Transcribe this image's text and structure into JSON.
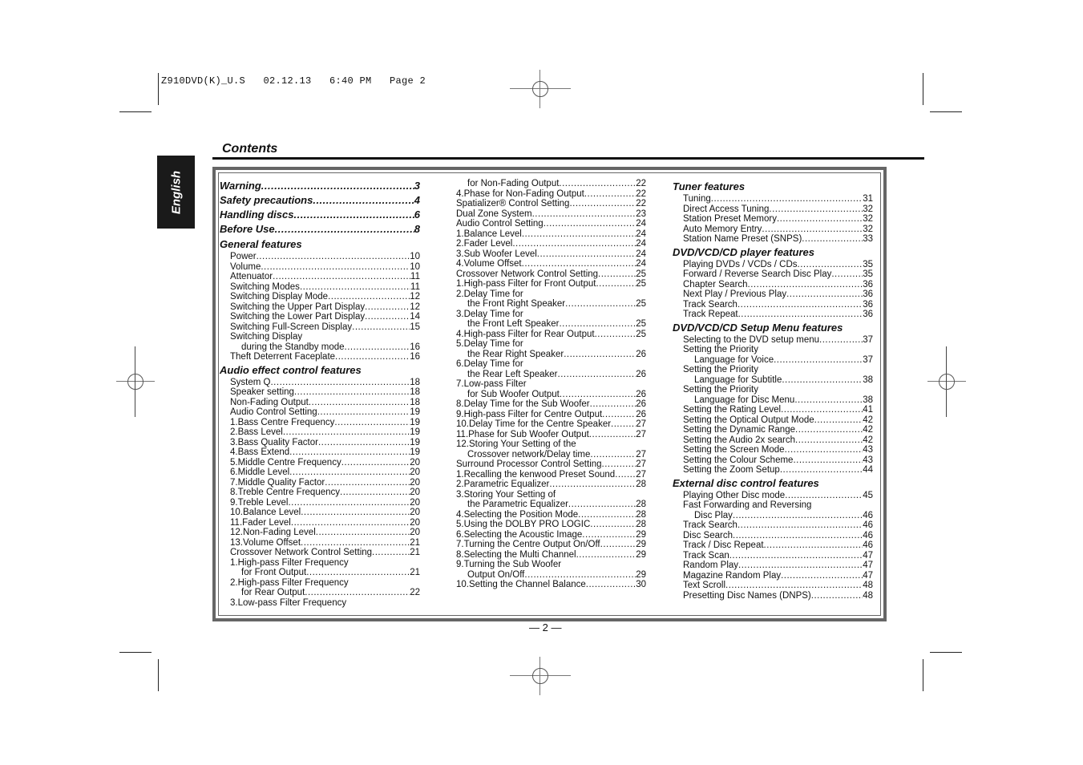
{
  "print_slug": "Z910DVD(K)_U.S   02.12.13   6:40 PM   Page 2",
  "language_tab": "English",
  "title": "Contents",
  "page_number": "— 2 —",
  "columns": [
    [
      {
        "type": "major",
        "text": "Warning",
        "page": "3"
      },
      {
        "type": "major",
        "text": "Safety precautions",
        "page": "4"
      },
      {
        "type": "major",
        "text": "Handling discs",
        "page": "6"
      },
      {
        "type": "major",
        "text": "Before Use",
        "page": "8"
      },
      {
        "type": "section",
        "text": "General features"
      },
      {
        "type": "item",
        "indent": 1,
        "text": "Power",
        "page": "10"
      },
      {
        "type": "item",
        "indent": 1,
        "text": "Volume",
        "page": "10"
      },
      {
        "type": "item",
        "indent": 1,
        "text": "Attenuator",
        "page": "11"
      },
      {
        "type": "item",
        "indent": 1,
        "text": "Switching Modes",
        "page": "11"
      },
      {
        "type": "item",
        "indent": 1,
        "text": "Switching Display Mode",
        "page": "12"
      },
      {
        "type": "item",
        "indent": 1,
        "text": "Switching the Upper Part Display",
        "page": "12"
      },
      {
        "type": "item",
        "indent": 1,
        "text": "Switching the Lower Part Display",
        "page": "14"
      },
      {
        "type": "item",
        "indent": 1,
        "text": "Switching Full-Screen Display",
        "page": "15"
      },
      {
        "type": "line",
        "indent": 1,
        "text": "Switching Display"
      },
      {
        "type": "item",
        "indent": 2,
        "text": "during the Standby mode",
        "page": "16"
      },
      {
        "type": "item",
        "indent": 1,
        "text": "Theft Deterrent Faceplate",
        "page": "16"
      },
      {
        "type": "section",
        "text": "Audio effect control features"
      },
      {
        "type": "item",
        "indent": 1,
        "text": "System Q",
        "page": "18"
      },
      {
        "type": "item",
        "indent": 1,
        "text": "Speaker setting",
        "page": "18"
      },
      {
        "type": "item",
        "indent": 1,
        "text": "Non-Fading Output",
        "page": "18"
      },
      {
        "type": "item",
        "indent": 1,
        "text": "Audio Control Setting",
        "page": "19"
      },
      {
        "type": "item",
        "indent": 1,
        "text": "1.Bass Centre Frequency",
        "page": "19"
      },
      {
        "type": "item",
        "indent": 1,
        "text": "2.Bass Level",
        "page": "19"
      },
      {
        "type": "item",
        "indent": 1,
        "text": "3.Bass Quality Factor",
        "page": "19"
      },
      {
        "type": "item",
        "indent": 1,
        "text": "4.Bass Extend",
        "page": "19"
      },
      {
        "type": "item",
        "indent": 1,
        "text": "5.Middle Centre Frequency",
        "page": "20"
      },
      {
        "type": "item",
        "indent": 1,
        "text": "6.Middle Level",
        "page": "20"
      },
      {
        "type": "item",
        "indent": 1,
        "text": "7.Middle Quality Factor",
        "page": "20"
      },
      {
        "type": "item",
        "indent": 1,
        "text": "8.Treble Centre Frequency",
        "page": "20"
      },
      {
        "type": "item",
        "indent": 1,
        "text": "9.Treble Level",
        "page": "20"
      },
      {
        "type": "item",
        "indent": 1,
        "text": "10.Balance Level",
        "page": "20"
      },
      {
        "type": "item",
        "indent": 1,
        "text": "11.Fader Level",
        "page": "20"
      },
      {
        "type": "item",
        "indent": 1,
        "text": "12.Non-Fading Level",
        "page": "20"
      },
      {
        "type": "item",
        "indent": 1,
        "text": "13.Volume Offset",
        "page": "21"
      },
      {
        "type": "item",
        "indent": 1,
        "text": "Crossover Network Control Setting",
        "page": "21"
      },
      {
        "type": "line",
        "indent": 1,
        "text": "1.High-pass Filter Frequency"
      },
      {
        "type": "item",
        "indent": 2,
        "text": "for Front Output",
        "page": "21"
      },
      {
        "type": "line",
        "indent": 1,
        "text": "2.High-pass Filter Frequency"
      },
      {
        "type": "item",
        "indent": 2,
        "text": "for Rear Output",
        "page": "22"
      },
      {
        "type": "line",
        "indent": 1,
        "text": "3.Low-pass Filter Frequency"
      }
    ],
    [
      {
        "type": "item",
        "indent": 1,
        "text": "for Non-Fading Output",
        "page": "22"
      },
      {
        "type": "item",
        "indent": 0,
        "text": "4.Phase for Non-Fading Output",
        "page": "22"
      },
      {
        "type": "item",
        "indent": 0,
        "text": "Spatializer® Control Setting",
        "page": "22"
      },
      {
        "type": "item",
        "indent": 0,
        "text": "Dual Zone System",
        "page": "23"
      },
      {
        "type": "item",
        "indent": 0,
        "text": "Audio Control Setting",
        "page": "24"
      },
      {
        "type": "item",
        "indent": 0,
        "text": "1.Balance Level",
        "page": "24"
      },
      {
        "type": "item",
        "indent": 0,
        "text": "2.Fader Level",
        "page": "24"
      },
      {
        "type": "item",
        "indent": 0,
        "text": "3.Sub Woofer Level",
        "page": "24"
      },
      {
        "type": "item",
        "indent": 0,
        "text": "4.Volume Offset",
        "page": "24"
      },
      {
        "type": "item",
        "indent": 0,
        "text": "Crossover Network Control Setting",
        "page": "25"
      },
      {
        "type": "item",
        "indent": 0,
        "text": "1.High-pass Filter for Front Output",
        "page": "25"
      },
      {
        "type": "line",
        "indent": 0,
        "text": "2.Delay Time for"
      },
      {
        "type": "item",
        "indent": 1,
        "text": "the Front Right Speaker",
        "page": "25"
      },
      {
        "type": "line",
        "indent": 0,
        "text": "3.Delay Time for"
      },
      {
        "type": "item",
        "indent": 1,
        "text": "the Front Left Speaker",
        "page": "25"
      },
      {
        "type": "item",
        "indent": 0,
        "text": "4.High-pass Filter for Rear Output",
        "page": "25"
      },
      {
        "type": "line",
        "indent": 0,
        "text": "5.Delay Time for"
      },
      {
        "type": "item",
        "indent": 1,
        "text": "the Rear Right Speaker",
        "page": "26"
      },
      {
        "type": "line",
        "indent": 0,
        "text": "6.Delay Time for"
      },
      {
        "type": "item",
        "indent": 1,
        "text": "the Rear Left Speaker",
        "page": "26"
      },
      {
        "type": "line",
        "indent": 0,
        "text": "7.Low-pass Filter"
      },
      {
        "type": "item",
        "indent": 1,
        "text": "for Sub Woofer Output",
        "page": "26"
      },
      {
        "type": "item",
        "indent": 0,
        "text": "8.Delay Time for the Sub Woofer",
        "page": "26"
      },
      {
        "type": "item",
        "indent": 0,
        "text": "9.High-pass Filter for Centre Output",
        "page": "26"
      },
      {
        "type": "item",
        "indent": 0,
        "text": "10.Delay Time for the Centre Speaker",
        "page": "27"
      },
      {
        "type": "item",
        "indent": 0,
        "text": "11.Phase for Sub Woofer Output",
        "page": "27"
      },
      {
        "type": "line",
        "indent": 0,
        "text": "12.Storing Your Setting of the"
      },
      {
        "type": "item",
        "indent": 1,
        "text": "Crossover network/Delay time",
        "page": "27"
      },
      {
        "type": "item",
        "indent": 0,
        "text": "Surround Processor Control Setting",
        "page": "27"
      },
      {
        "type": "item",
        "indent": 0,
        "text": "1.Recalling the kenwood Preset Sound",
        "page": "27"
      },
      {
        "type": "item",
        "indent": 0,
        "text": "2.Parametric Equalizer",
        "page": "28"
      },
      {
        "type": "line",
        "indent": 0,
        "text": "3.Storing Your Setting of"
      },
      {
        "type": "item",
        "indent": 1,
        "text": "the Parametric Equalizer",
        "page": "28"
      },
      {
        "type": "item",
        "indent": 0,
        "text": "4.Selecting the Position Mode",
        "page": "28"
      },
      {
        "type": "item",
        "indent": 0,
        "text": "5.Using the DOLBY PRO LOGIC",
        "page": "28"
      },
      {
        "type": "item",
        "indent": 0,
        "text": "6.Selecting the Acoustic Image",
        "page": "29"
      },
      {
        "type": "item",
        "indent": 0,
        "text": "7.Turning the Centre Output On/Off",
        "page": "29"
      },
      {
        "type": "item",
        "indent": 0,
        "text": "8.Selecting the Multi Channel",
        "page": "29"
      },
      {
        "type": "line",
        "indent": 0,
        "text": "9.Turning the Sub Woofer"
      },
      {
        "type": "item",
        "indent": 1,
        "text": "Output On/Off",
        "page": "29"
      },
      {
        "type": "item",
        "indent": 0,
        "text": "10.Setting the Channel Balance",
        "page": "30"
      }
    ],
    [
      {
        "type": "section",
        "text": "Tuner features"
      },
      {
        "type": "item",
        "indent": 1,
        "text": "Tuning",
        "page": "31"
      },
      {
        "type": "item",
        "indent": 1,
        "text": "Direct Access Tuning",
        "page": "32"
      },
      {
        "type": "item",
        "indent": 1,
        "text": "Station Preset Memory",
        "page": "32"
      },
      {
        "type": "item",
        "indent": 1,
        "text": "Auto Memory Entry",
        "page": "32"
      },
      {
        "type": "item",
        "indent": 1,
        "text": "Station Name Preset (SNPS)",
        "page": "33"
      },
      {
        "type": "section",
        "text": "DVD/VCD/CD player features"
      },
      {
        "type": "item",
        "indent": 1,
        "text": "Playing DVDs / VCDs / CDs",
        "page": "35"
      },
      {
        "type": "item",
        "indent": 1,
        "text": "Forward / Reverse Search Disc Play",
        "page": "35"
      },
      {
        "type": "item",
        "indent": 1,
        "text": "Chapter Search",
        "page": "36"
      },
      {
        "type": "item",
        "indent": 1,
        "text": "Next Play / Previous Play",
        "page": "36"
      },
      {
        "type": "item",
        "indent": 1,
        "text": "Track Search",
        "page": "36"
      },
      {
        "type": "item",
        "indent": 1,
        "text": "Track Repeat",
        "page": "36"
      },
      {
        "type": "section",
        "text": "DVD/VCD/CD Setup Menu features"
      },
      {
        "type": "item",
        "indent": 1,
        "text": "Selecting to the DVD setup menu",
        "page": "37"
      },
      {
        "type": "line",
        "indent": 1,
        "text": "Setting the Priority"
      },
      {
        "type": "item",
        "indent": 2,
        "text": "Language for Voice",
        "page": "37"
      },
      {
        "type": "line",
        "indent": 1,
        "text": "Setting the Priority"
      },
      {
        "type": "item",
        "indent": 2,
        "text": "Language for Subtitle",
        "page": "38"
      },
      {
        "type": "line",
        "indent": 1,
        "text": "Setting the Priority"
      },
      {
        "type": "item",
        "indent": 2,
        "text": "Language for Disc Menu",
        "page": "38"
      },
      {
        "type": "item",
        "indent": 1,
        "text": "Setting the Rating Level",
        "page": "41"
      },
      {
        "type": "item",
        "indent": 1,
        "text": "Setting the Optical Output Mode",
        "page": "42"
      },
      {
        "type": "item",
        "indent": 1,
        "text": "Setting the Dynamic Range",
        "page": "42"
      },
      {
        "type": "item",
        "indent": 1,
        "text": "Setting the Audio 2x search",
        "page": "42"
      },
      {
        "type": "item",
        "indent": 1,
        "text": "Setting the Screen Mode",
        "page": "43"
      },
      {
        "type": "item",
        "indent": 1,
        "text": "Setting the Colour Scheme",
        "page": "43"
      },
      {
        "type": "item",
        "indent": 1,
        "text": "Setting the Zoom Setup",
        "page": "44"
      },
      {
        "type": "section",
        "text": "External disc control features"
      },
      {
        "type": "item",
        "indent": 1,
        "text": "Playing Other Disc mode",
        "page": "45"
      },
      {
        "type": "line",
        "indent": 1,
        "text": "Fast Forwarding and Reversing"
      },
      {
        "type": "item",
        "indent": 2,
        "text": "Disc Play",
        "page": "46"
      },
      {
        "type": "item",
        "indent": 1,
        "text": "Track Search",
        "page": "46"
      },
      {
        "type": "item",
        "indent": 1,
        "text": "Disc Search",
        "page": "46"
      },
      {
        "type": "item",
        "indent": 1,
        "text": "Track / Disc Repeat",
        "page": "46"
      },
      {
        "type": "item",
        "indent": 1,
        "text": "Track Scan",
        "page": "47"
      },
      {
        "type": "item",
        "indent": 1,
        "text": "Random Play",
        "page": "47"
      },
      {
        "type": "item",
        "indent": 1,
        "text": "Magazine Random Play",
        "page": "47"
      },
      {
        "type": "item",
        "indent": 1,
        "text": "Text Scroll",
        "page": "48"
      },
      {
        "type": "item",
        "indent": 1,
        "text": "Presetting Disc Names (DNPS)",
        "page": "48"
      }
    ]
  ]
}
